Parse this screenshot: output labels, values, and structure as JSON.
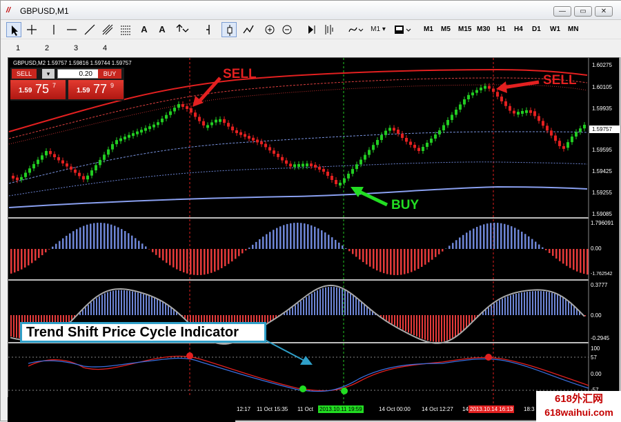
{
  "window": {
    "title": "GBPUSD,M1",
    "app_icon": "metatrader-icon"
  },
  "window_buttons": {
    "minimize": "—",
    "maximize": "▭",
    "close": "✕"
  },
  "toolbar": {
    "text_tool": "A",
    "label_tool": "A",
    "timeframes": [
      "M1",
      "M5",
      "M15",
      "M30",
      "H1",
      "H4",
      "D1",
      "W1",
      "MN"
    ],
    "period_dropdown": "M1"
  },
  "number_row": [
    "1",
    "2",
    "3",
    "4"
  ],
  "chart": {
    "pair_label": "GBPUSD,M2  1.59757 1.59816 1.59744 1.59757",
    "price_axis": [
      "1.60275",
      "1.60105",
      "1.59935",
      "1.59757",
      "1.59595",
      "1.59425",
      "1.59255",
      "1.59085"
    ],
    "current_price": "1.59757",
    "osc1_axis": [
      "1.796091",
      "0.00",
      "-1.762542"
    ],
    "osc2_axis": [
      "0.3777",
      "0.00",
      "-0.2945"
    ],
    "osc3_axis": [
      "100",
      "57",
      "0.00",
      "-57"
    ],
    "time_labels": [
      "12:17",
      "11 Oct 15:35",
      "11 Oct",
      "14 Oct 00:00",
      "14 Oct 12:27",
      "14",
      "18:3"
    ],
    "time_highlight_buy": "2013.10.11 19:59",
    "time_highlight_sell": "2013.10.14 16:13"
  },
  "trade_panel": {
    "sell_label": "SELL",
    "buy_label": "BUY",
    "lots": "0.20",
    "sell_price_small": "1.59",
    "sell_price_big": "75",
    "sell_price_sup": "7",
    "buy_price_small": "1.59",
    "buy_price_big": "77",
    "buy_price_sup": "9"
  },
  "annotations": {
    "sell_left": "SELL",
    "sell_right": "SELL",
    "buy": "BUY",
    "indicator_name": "Trend Shift Price Cycle Indicator"
  },
  "watermark": {
    "line1": "618外汇网",
    "line2": "618waihui.com"
  },
  "colors": {
    "bull": "#22cc22",
    "bear": "#e32020",
    "histo_pos": "#6e86d6",
    "histo_neg": "#e53a3a",
    "label_border": "#2f9fc8"
  }
}
